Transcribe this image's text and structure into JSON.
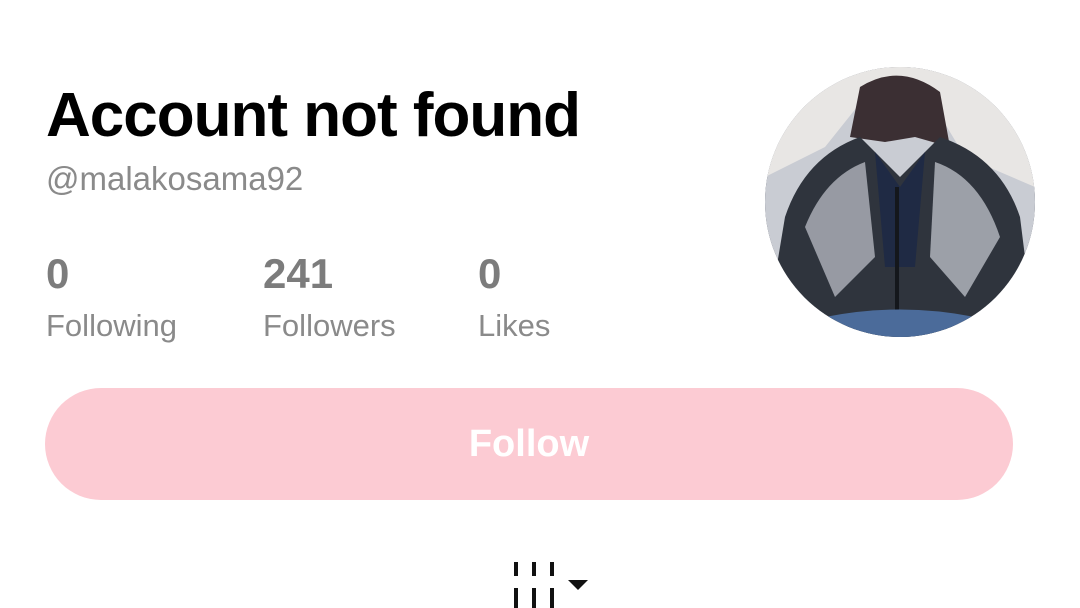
{
  "profile": {
    "title": "Account not found",
    "handle": "@malakosama92"
  },
  "stats": [
    {
      "value": "0",
      "label": "Following"
    },
    {
      "value": "241",
      "label": "Followers"
    },
    {
      "value": "0",
      "label": "Likes"
    }
  ],
  "follow_button": {
    "label": "Follow",
    "color": "#fccbd3"
  },
  "icons": {
    "avatar": "profile-photo",
    "grid_toggle": "grid-view-icon",
    "dropdown": "caret-down-icon"
  }
}
